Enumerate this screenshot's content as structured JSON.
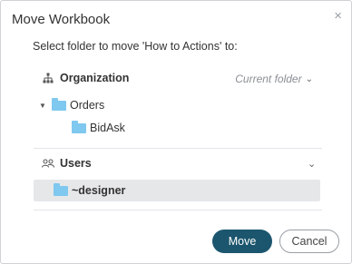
{
  "dialog": {
    "title": "Move Workbook",
    "close_icon": "×",
    "instruction": "Select folder to move 'How to Actions' to:"
  },
  "organization": {
    "label": "Organization",
    "icon": "org-tree-icon",
    "current_folder_label": "Current folder",
    "tree": [
      {
        "label": "Orders",
        "expanded": true
      },
      {
        "label": "BidAsk"
      }
    ]
  },
  "users": {
    "label": "Users",
    "icon": "users-icon",
    "tree": [
      {
        "label": "~designer",
        "selected": true
      }
    ]
  },
  "buttons": {
    "move": "Move",
    "cancel": "Cancel"
  },
  "colors": {
    "primary": "#1c566e",
    "folder": "#7fc8ef",
    "selection": "#e6e7e9"
  }
}
